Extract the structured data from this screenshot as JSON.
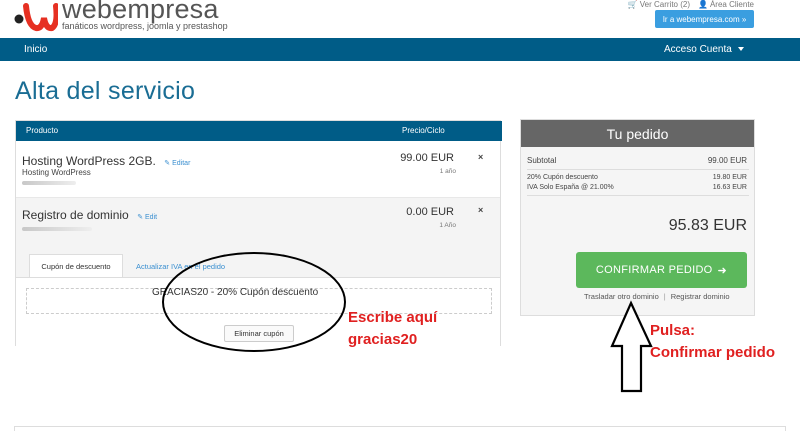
{
  "header": {
    "logo_text": "webempresa",
    "tagline": "fanáticos wordpress, joomla y prestashop",
    "cart_link": "Ver Carrito (2)",
    "client_area_link": "Área Cliente",
    "goto_button": "Ir a webempresa.com »"
  },
  "nav": {
    "home": "Inicio",
    "account": "Acceso Cuenta"
  },
  "page": {
    "title": "Alta del servicio"
  },
  "cart": {
    "columns": {
      "product": "Producto",
      "price": "Precio/Ciclo"
    },
    "items": [
      {
        "name": "Hosting WordPress 2GB.",
        "edit": "Editar",
        "sub": "Hosting WordPress",
        "price": "99.00 EUR",
        "cycle": "1 año"
      },
      {
        "name": "Registro de dominio",
        "edit": "Edit",
        "price": "0.00 EUR",
        "cycle": "1 Año"
      }
    ],
    "remove_symbol": "×",
    "tabs": {
      "coupon": "Cupón de descuento",
      "vat": "Actualizar IVA en el pedido"
    },
    "coupon_applied": "GRACIAS20 - 20% Cupón descuento",
    "remove_coupon": "Eliminar cupón"
  },
  "summary": {
    "title": "Tu pedido",
    "subtotal_label": "Subtotal",
    "subtotal_value": "99.00 EUR",
    "discount_label": "20% Cupón descuento",
    "discount_value": "19.80 EUR",
    "vat_label": "IVA Solo España @ 21.00%",
    "vat_value": "16.63 EUR",
    "total": "95.83 EUR",
    "confirm_button": "CONFIRMAR PEDIDO",
    "transfer_link": "Trasladar otro dominio",
    "register_link": "Registrar dominio"
  },
  "annotations": {
    "write_here_1": "Escribe aquí",
    "write_here_2": "gracias20",
    "press_1": "Pulsa:",
    "press_2": "Confirmar pedido",
    "color": "#e02020"
  },
  "colors": {
    "brand": "#005c87",
    "accent": "#3a9ee0",
    "confirm": "#5cb85c",
    "logo_red": "#e63022"
  }
}
